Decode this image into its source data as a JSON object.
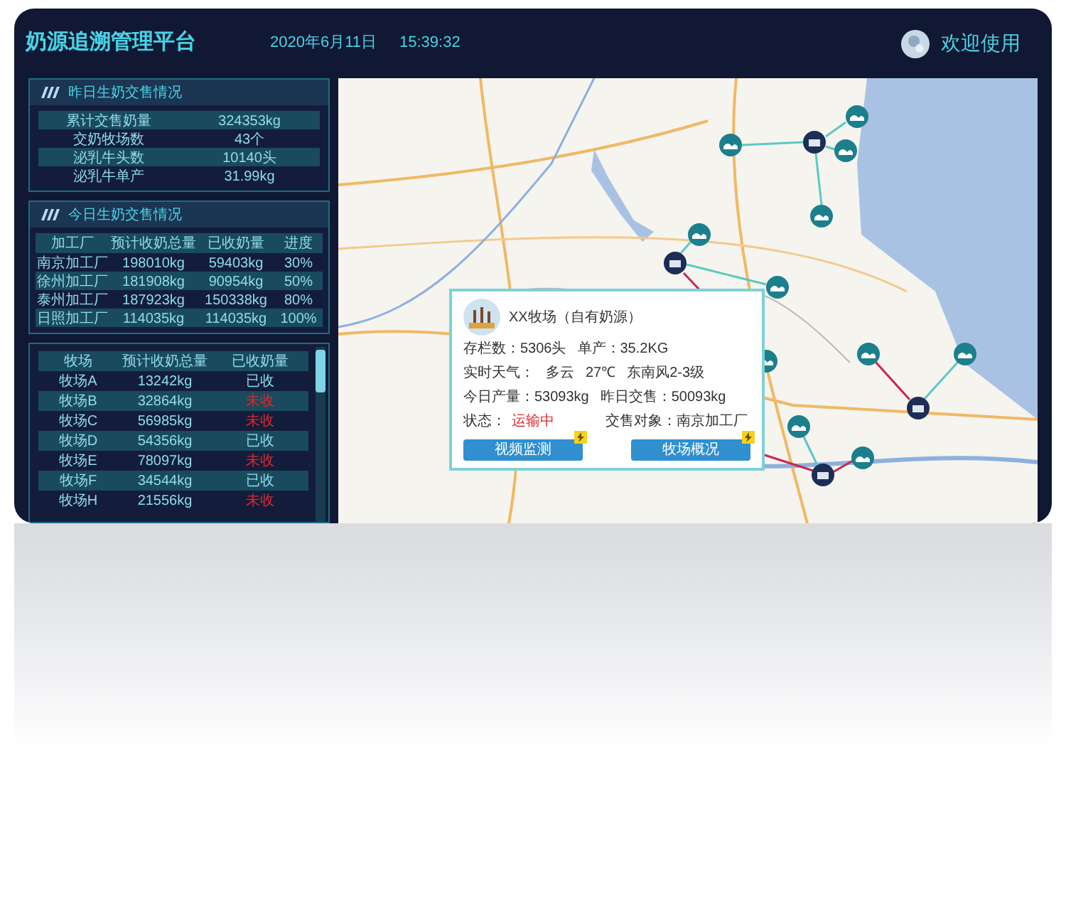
{
  "header": {
    "title": "奶源追溯管理平台",
    "date": "2020年6月11日",
    "time": "15:39:32",
    "welcome": "欢迎使用"
  },
  "yesterday_panel": {
    "title": "昨日生奶交售情况",
    "rows": [
      {
        "label": "累计交售奶量",
        "value": "324353kg"
      },
      {
        "label": "交奶牧场数",
        "value": "43个"
      },
      {
        "label": "泌乳牛头数",
        "value": "10140头"
      },
      {
        "label": "泌乳牛单产",
        "value": "31.99kg"
      }
    ]
  },
  "today_panel": {
    "title": "今日生奶交售情况",
    "columns": [
      "加工厂",
      "预计收奶总量",
      "已收奶量",
      "进度"
    ],
    "rows": [
      [
        "南京加工厂",
        "198010kg",
        "59403kg",
        "30%"
      ],
      [
        "徐州加工厂",
        "181908kg",
        "90954kg",
        "50%"
      ],
      [
        "泰州加工厂",
        "187923kg",
        "150338kg",
        "80%"
      ],
      [
        "日照加工厂",
        "114035kg",
        "114035kg",
        "100%"
      ]
    ]
  },
  "farm_table": {
    "columns": [
      "牧场",
      "预计收奶总量",
      "已收奶量"
    ],
    "rows": [
      {
        "farm": "牧场A",
        "expected": "13242kg",
        "status": "已收",
        "received": true
      },
      {
        "farm": "牧场B",
        "expected": "32864kg",
        "status": "未收",
        "received": false
      },
      {
        "farm": "牧场C",
        "expected": "56985kg",
        "status": "未收",
        "received": false
      },
      {
        "farm": "牧场D",
        "expected": "54356kg",
        "status": "已收",
        "received": true
      },
      {
        "farm": "牧场E",
        "expected": "78097kg",
        "status": "未收",
        "received": false
      },
      {
        "farm": "牧场F",
        "expected": "34544kg",
        "status": "已收",
        "received": true
      },
      {
        "farm": "牧场H",
        "expected": "21556kg",
        "status": "未收",
        "received": false
      }
    ]
  },
  "map": {
    "kind": "picture",
    "popup": {
      "name": "XX牧场（自有奶源）",
      "lines": [
        [
          "存栏数：5306头",
          "单产：35.2KG"
        ],
        [
          "实时天气：",
          "多云",
          "27℃",
          "东南风2-3级"
        ],
        [
          "今日产量：53093kg",
          "昨日交售：50093kg"
        ]
      ],
      "status_label": "状态：",
      "status": "运输中",
      "buyer": "交售对象：南京加工厂",
      "buttons": [
        "视频监测",
        "牧场概况"
      ]
    }
  }
}
